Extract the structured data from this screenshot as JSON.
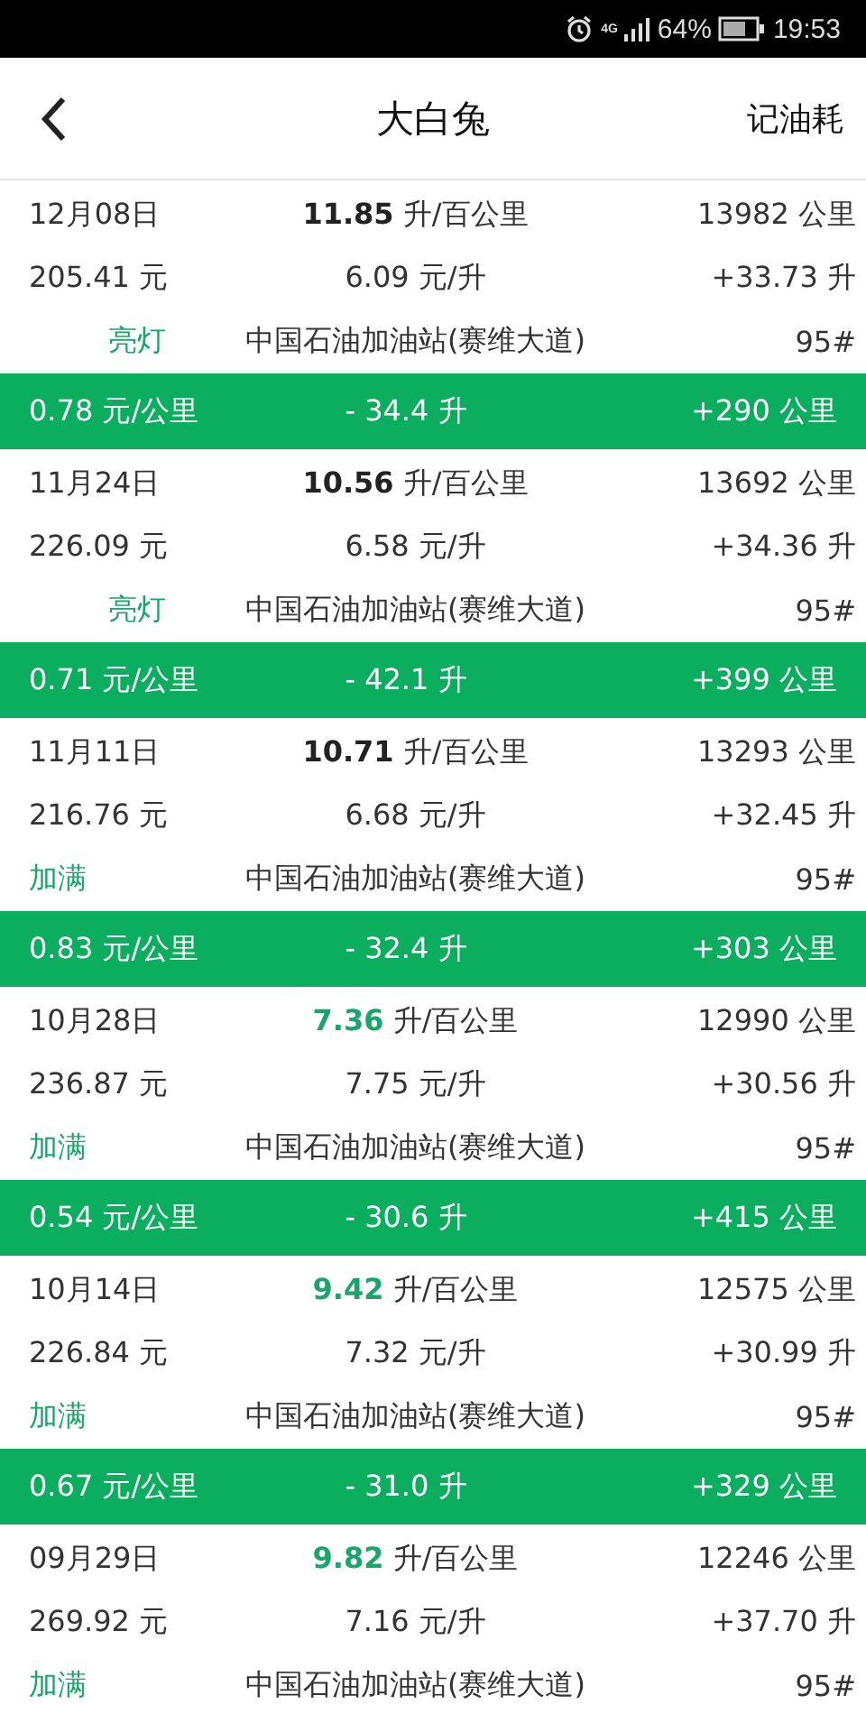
{
  "status_bar": {
    "network": "4G",
    "battery": "64%",
    "time": "19:53"
  },
  "header": {
    "title": "大白兔",
    "action": "记油耗"
  },
  "records": [
    {
      "date": "12月08日",
      "consumption": "11.85",
      "consumption_unit": "升/百公里",
      "color": "#222222",
      "odometer": "13982 公里",
      "cost": "205.41 元",
      "price": "6.09 元/升",
      "volume": "+33.73 升",
      "fill": {
        "text": "亮灯",
        "kind": "light"
      },
      "station": "中国石油加油站(赛维大道)",
      "grade": "95#",
      "interval": {
        "cost_per_km": "0.78 元/公里",
        "used": "- 34.4 升",
        "distance": "+290 公里"
      }
    },
    {
      "date": "11月24日",
      "consumption": "10.56",
      "consumption_unit": "升/百公里",
      "color": "#222222",
      "odometer": "13692 公里",
      "cost": "226.09 元",
      "price": "6.58 元/升",
      "volume": "+34.36 升",
      "fill": {
        "text": "亮灯",
        "kind": "light"
      },
      "station": "中国石油加油站(赛维大道)",
      "grade": "95#",
      "interval": {
        "cost_per_km": "0.71 元/公里",
        "used": "- 42.1 升",
        "distance": "+399 公里"
      }
    },
    {
      "date": "11月11日",
      "consumption": "10.71",
      "consumption_unit": "升/百公里",
      "color": "#222222",
      "odometer": "13293 公里",
      "cost": "216.76 元",
      "price": "6.68 元/升",
      "volume": "+32.45 升",
      "fill": {
        "text": "加满",
        "kind": "full"
      },
      "station": "中国石油加油站(赛维大道)",
      "grade": "95#",
      "interval": {
        "cost_per_km": "0.83 元/公里",
        "used": "- 32.4 升",
        "distance": "+303 公里"
      }
    },
    {
      "date": "10月28日",
      "consumption": "7.36",
      "consumption_unit": "升/百公里",
      "color": "#1aa56a",
      "odometer": "12990 公里",
      "cost": "236.87 元",
      "price": "7.75 元/升",
      "volume": "+30.56 升",
      "fill": {
        "text": "加满",
        "kind": "full"
      },
      "station": "中国石油加油站(赛维大道)",
      "grade": "95#",
      "interval": {
        "cost_per_km": "0.54 元/公里",
        "used": "- 30.6 升",
        "distance": "+415 公里"
      }
    },
    {
      "date": "10月14日",
      "consumption": "9.42",
      "consumption_unit": "升/百公里",
      "color": "#1aa56a",
      "odometer": "12575 公里",
      "cost": "226.84 元",
      "price": "7.32 元/升",
      "volume": "+30.99 升",
      "fill": {
        "text": "加满",
        "kind": "full"
      },
      "station": "中国石油加油站(赛维大道)",
      "grade": "95#",
      "interval": {
        "cost_per_km": "0.67 元/公里",
        "used": "- 31.0 升",
        "distance": "+329 公里"
      }
    },
    {
      "date": "09月29日",
      "consumption": "9.82",
      "consumption_unit": "升/百公里",
      "color": "#1aa56a",
      "odometer": "12246 公里",
      "cost": "269.92 元",
      "price": "7.16 元/升",
      "volume": "+37.70 升",
      "fill": {
        "text": "加满",
        "kind": "full"
      },
      "station": "中国石油加油站(赛维大道)",
      "grade": "95#"
    }
  ]
}
